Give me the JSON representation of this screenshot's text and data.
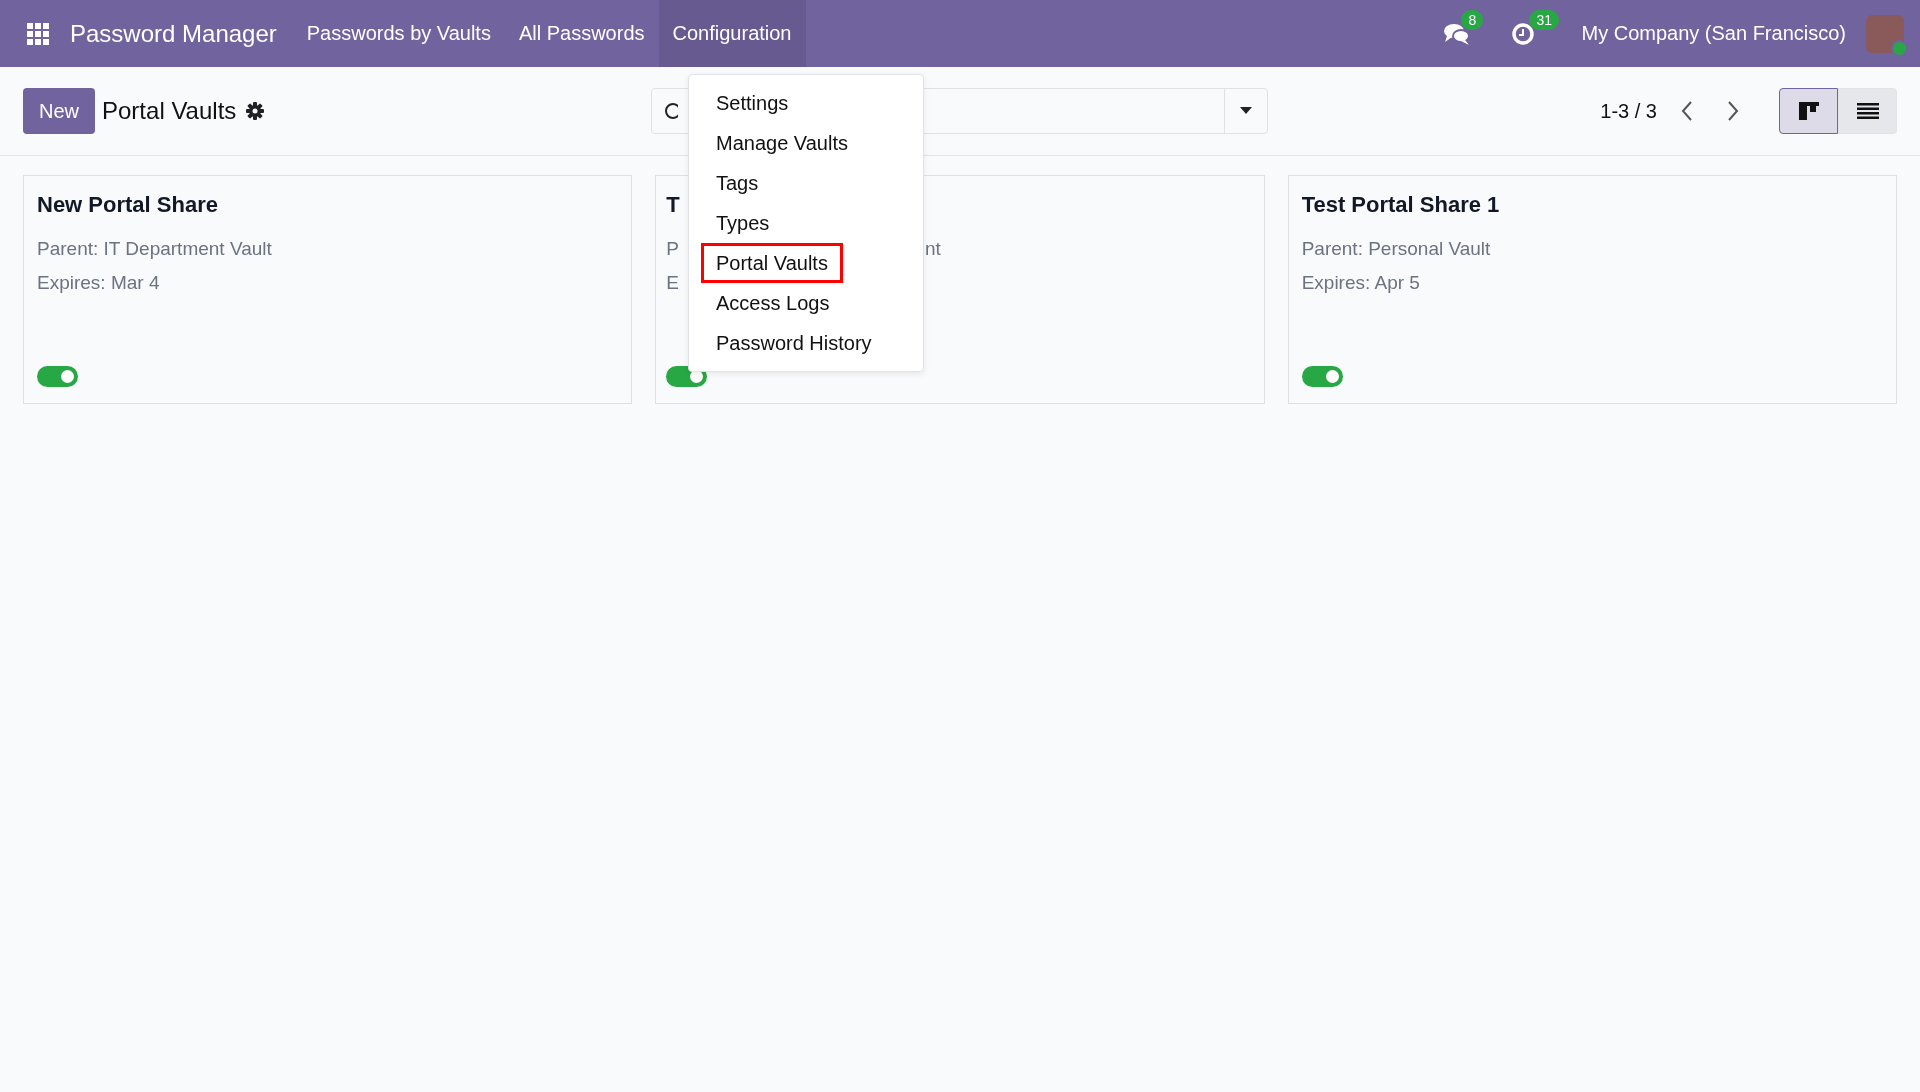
{
  "navbar": {
    "app_title": "Password Manager",
    "menu": [
      {
        "label": "Passwords by Vaults",
        "selected": false
      },
      {
        "label": "All Passwords",
        "selected": false
      },
      {
        "label": "Configuration",
        "selected": true
      }
    ],
    "messages_count": "8",
    "activities_count": "31",
    "company": "My Company (San Francisco)"
  },
  "control_panel": {
    "new_button": "New",
    "breadcrumb": "Portal Vaults",
    "pager": "1-3 / 3",
    "views": [
      {
        "kind": "kanban",
        "selected": true
      },
      {
        "kind": "list",
        "selected": false
      }
    ]
  },
  "dropdown": {
    "items": [
      {
        "label": "Settings",
        "highlighted": false
      },
      {
        "label": "Manage Vaults",
        "highlighted": false
      },
      {
        "label": "Tags",
        "highlighted": false
      },
      {
        "label": "Types",
        "highlighted": false
      },
      {
        "label": "Portal Vaults",
        "highlighted": true
      },
      {
        "label": "Access Logs",
        "highlighted": false
      },
      {
        "label": "Password History",
        "highlighted": false
      }
    ]
  },
  "cards": [
    {
      "title": "New Portal Share",
      "parent": "Parent: IT Department Vault",
      "expires": "Expires: Mar 4",
      "on": true
    },
    {
      "title": "T",
      "parent": "P",
      "parent_tail": "nt",
      "expires": "E",
      "on": true
    },
    {
      "title": "Test Portal Share 1",
      "parent": "Parent: Personal Vault",
      "expires": "Expires: Apr 5",
      "on": true
    }
  ]
}
